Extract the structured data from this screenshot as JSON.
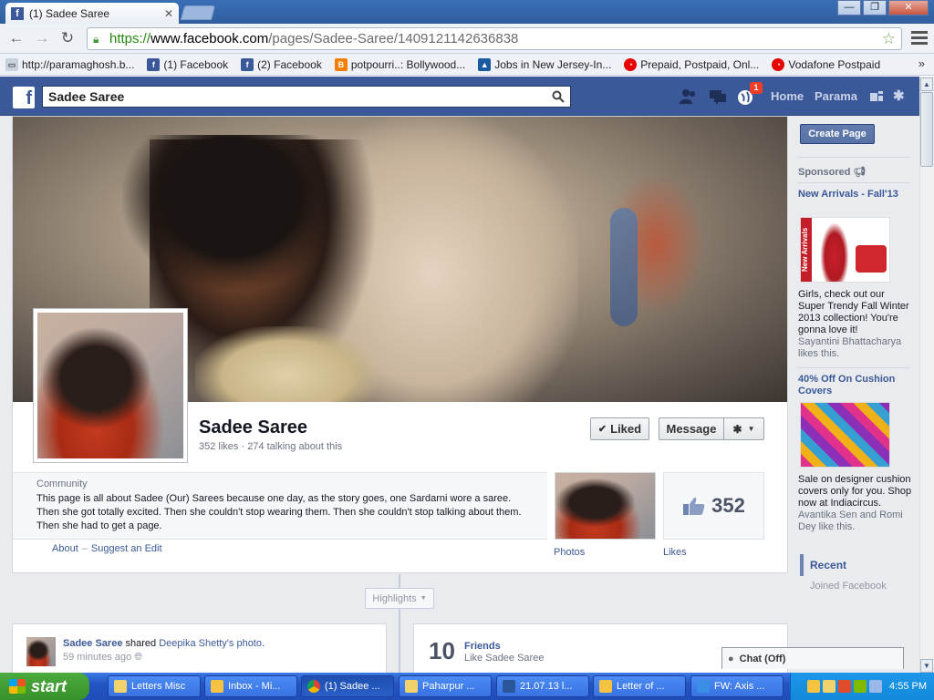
{
  "browser": {
    "tab_title": "(1) Sadee Saree",
    "tab_favicon": "f",
    "url_scheme": "https://",
    "url_domain": "www.facebook.com",
    "url_path": "/pages/Sadee-Saree/1409121142636838",
    "bookmarks": [
      {
        "label": "http://paramaghosh.b...",
        "icon": "generic-page-icon"
      },
      {
        "label": "(1) Facebook",
        "icon": "facebook-icon"
      },
      {
        "label": "(2) Facebook",
        "icon": "facebook-icon"
      },
      {
        "label": "potpourri..: Bollywood...",
        "icon": "blogger-icon"
      },
      {
        "label": "Jobs in New Jersey-In...",
        "icon": "jobs-icon"
      },
      {
        "label": "Prepaid, Postpaid, Onl...",
        "icon": "vodafone-icon"
      },
      {
        "label": "Vodafone Postpaid",
        "icon": "vodafone-icon"
      }
    ],
    "bookmarks_more": "»"
  },
  "fb_header": {
    "search_value": "Sadee Saree",
    "notification_count": "1",
    "home_label": "Home",
    "user_label": "Parama"
  },
  "page": {
    "name": "Sadee Saree",
    "stats": "352 likes · 274 talking about this",
    "liked_label": "Liked",
    "message_label": "Message",
    "category": "Community",
    "description": "This page is all about Sadee (Our) Sarees because one day, as the story goes, one Sardarni wore a saree. Then she got totally excited. Then she couldn't stop wearing them. Then she couldn't stop talking about them. Then she had to get a page.",
    "about_link": "About",
    "link_sep": "–",
    "suggest_link": "Suggest an Edit",
    "photos_label": "Photos",
    "likes_count": "352",
    "likes_label": "Likes"
  },
  "timeline": {
    "highlights_label": "Highlights",
    "story_actor": "Sadee Saree",
    "story_verb": "shared",
    "story_object": "Deepika Shetty's photo.",
    "story_time": "59 minutes ago",
    "friends_count": "10",
    "friends_label": "Friends",
    "friends_sub": "Like Sadee Saree"
  },
  "right_col": {
    "create_page": "Create Page",
    "sponsored": "Sponsored",
    "ad1_title": "New Arrivals - Fall'13",
    "ad1_strip": "New Arrivals",
    "ad1_text": "Girls, check out our Super Trendy Fall Winter 2013 collection! You're gonna love it!",
    "ad1_social": "Sayantini Bhattacharya likes this.",
    "ad2_title": "40% Off On Cushion Covers",
    "ad2_text": "Sale on designer cushion covers only for you. Shop now at Indiacircus.",
    "ad2_social": "Avantika Sen and Romi Dey like this.",
    "recent_label": "Recent",
    "joined_label": "Joined Facebook"
  },
  "chat": {
    "label": "Chat (Off)"
  },
  "taskbar": {
    "start_label": "start",
    "tasks": [
      {
        "label": "Letters Misc",
        "icon": "folder-icon",
        "active": false
      },
      {
        "label": "Inbox - Mi...",
        "icon": "mail-icon",
        "active": false
      },
      {
        "label": "(1) Sadee ...",
        "icon": "chrome-icon",
        "active": true
      },
      {
        "label": "Paharpur ...",
        "icon": "folder-icon",
        "active": false
      },
      {
        "label": "21.07.13 l...",
        "icon": "word-icon",
        "active": false
      },
      {
        "label": "Letter of ...",
        "icon": "mail-icon",
        "active": false
      },
      {
        "label": "FW: Axis ...",
        "icon": "outlook-icon",
        "active": false
      }
    ],
    "clock": "4:55 PM"
  },
  "colors": {
    "fb_blue": "#3b5998",
    "link_blue": "#3b5998",
    "xp_taskbar": "#245edb",
    "xp_start": "#3c9a34"
  }
}
